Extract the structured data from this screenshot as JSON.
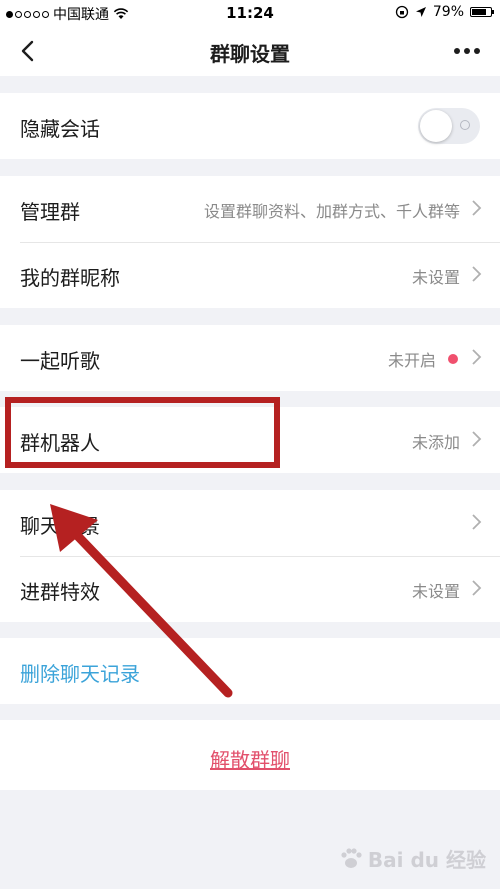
{
  "status_bar": {
    "carrier": "中国联通",
    "time": "11:24",
    "battery": "79%",
    "battery_level": 0.79
  },
  "nav": {
    "title": "群聊设置"
  },
  "settings": {
    "hide_chat": {
      "label": "隐藏会话",
      "enabled": false
    },
    "manage_group": {
      "label": "管理群",
      "value": "设置群聊资料、加群方式、千人群等"
    },
    "my_nickname": {
      "label": "我的群昵称",
      "value": "未设置"
    },
    "listen_together": {
      "label": "一起听歌",
      "value": "未开启"
    },
    "group_robot": {
      "label": "群机器人",
      "value": "未添加"
    },
    "chat_background": {
      "label": "聊天背景"
    },
    "join_effect": {
      "label": "进群特效",
      "value": "未设置"
    },
    "delete_history": {
      "label": "删除聊天记录"
    },
    "dissolve": {
      "label": "解散群聊"
    }
  },
  "annotation": {
    "color": "#b52121"
  },
  "colors": {
    "accent_link": "#3ba3d9",
    "danger": "#e2506c",
    "dot": "#f0506e"
  },
  "watermark": {
    "text": "Bai du 经验"
  }
}
